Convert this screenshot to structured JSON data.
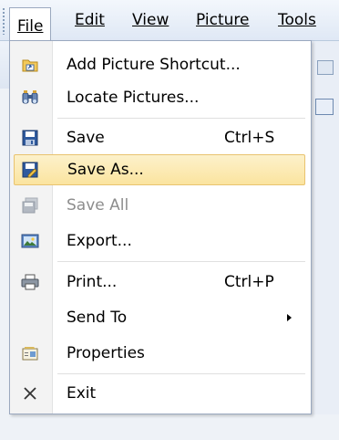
{
  "menubar": {
    "menus": [
      {
        "label": "File",
        "mnemonic": "F"
      },
      {
        "label": "Edit",
        "mnemonic": "E"
      },
      {
        "label": "View",
        "mnemonic": "V"
      },
      {
        "label": "Picture",
        "mnemonic": "P"
      },
      {
        "label": "Tools",
        "mnemonic": "T"
      }
    ]
  },
  "file_menu": {
    "items": [
      {
        "label": "Add Picture Shortcut...",
        "icon": "add-shortcut-icon"
      },
      {
        "label": "Locate Pictures...",
        "icon": "binoculars-icon"
      },
      {
        "label": "Save",
        "shortcut": "Ctrl+S",
        "icon": "floppy-disk-icon"
      },
      {
        "label": "Save As...",
        "icon": "save-as-icon",
        "highlighted": true
      },
      {
        "label": "Save All",
        "icon": "save-all-icon",
        "disabled": true
      },
      {
        "label": "Export...",
        "icon": "export-icon"
      },
      {
        "label": "Print...",
        "shortcut": "Ctrl+P",
        "icon": "printer-icon"
      },
      {
        "label": "Send To",
        "submenu": true
      },
      {
        "label": "Properties",
        "icon": "properties-icon"
      },
      {
        "label": "Exit",
        "icon": "close-x-icon"
      }
    ]
  },
  "colors": {
    "highlight_fill": "#fbe49f",
    "highlight_border": "#e9c36f",
    "disabled_text": "#8d8d8d",
    "menubar_bg": "#dfe8f5"
  }
}
